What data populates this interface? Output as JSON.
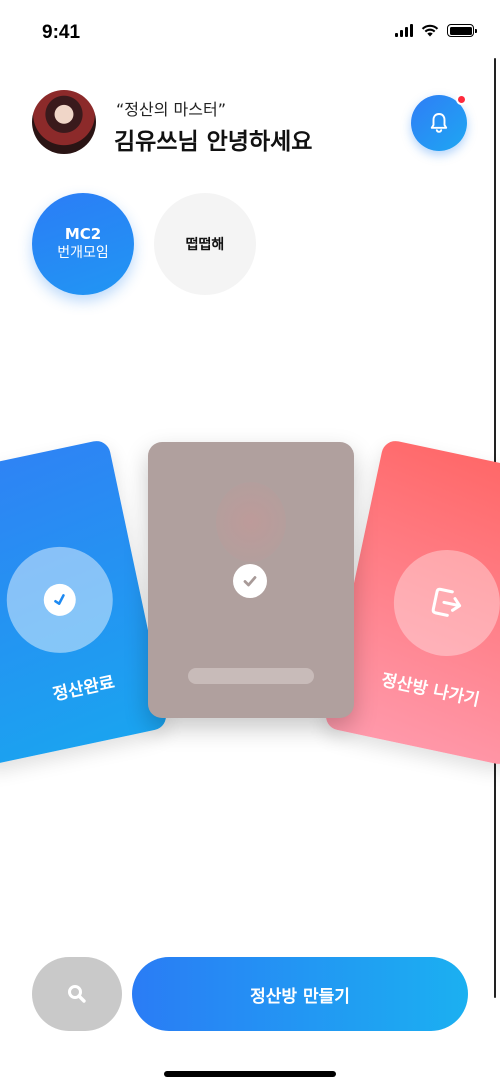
{
  "status_bar": {
    "time": "9:41",
    "icons": [
      "signal-icon",
      "wifi-icon",
      "battery-icon"
    ]
  },
  "header": {
    "subtitle": "“정산의 마스터”",
    "greeting": "김유쓰님 안녕하세요",
    "avatar": "profile-photo",
    "notification_icon": "bell-icon",
    "has_unread": true
  },
  "groups": [
    {
      "line1": "MC2",
      "line2": "번개모임",
      "selected": true
    },
    {
      "label": "떱떱해",
      "selected": false
    }
  ],
  "cards": {
    "left": {
      "label": "정산완료",
      "icon": "check-icon"
    },
    "center": {
      "icon": "check-icon"
    },
    "right": {
      "label": "정산방 나가기",
      "icon": "exit-icon"
    }
  },
  "bottom_bar": {
    "search_icon": "search-icon",
    "create_label": "정산방 만들기"
  },
  "colors": {
    "primary_blue": "#2A7CF5",
    "secondary_blue": "#1BB0F1",
    "exit_red": "#FF6666",
    "badge_red": "#FF2A3C",
    "inactive_gray": "#C9C9C9"
  }
}
